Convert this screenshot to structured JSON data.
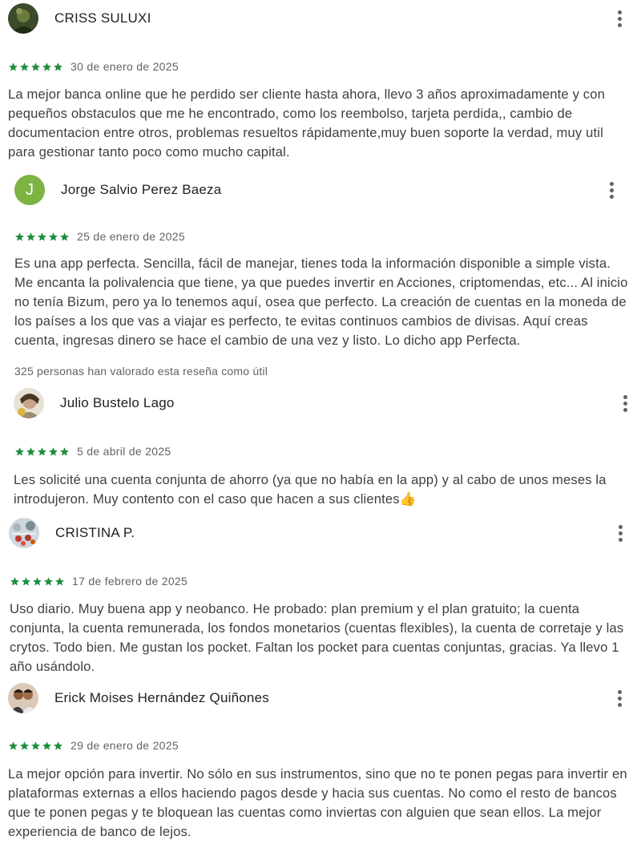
{
  "colors": {
    "star": "#1e8e3e",
    "avatar_letter_bg": "#7cb342",
    "text": "#3c4043",
    "muted": "#5f6368"
  },
  "reviews": [
    {
      "name": "CRISS SULUXI",
      "avatar": "photo",
      "rating": 5,
      "date": "30 de enero de 2025",
      "text": "La mejor banca online que he perdido ser cliente hasta ahora, llevo 3 años aproximadamente y con pequeños obstaculos que me he encontrado, como los reembolso, tarjeta perdida,, cambio de documentacion entre otros, problemas resueltos rápidamente,muy buen soporte la verdad, muy util para gestionar tanto poco como mucho capital."
    },
    {
      "name": "Jorge Salvio Perez Baeza",
      "avatar": "letter",
      "avatar_letter": "J",
      "rating": 5,
      "date": "25 de enero de 2025",
      "text": "Es una app perfecta. Sencilla, fácil de manejar, tienes toda la información disponible a simple vista. Me encanta la polivalencia que tiene, ya que puedes invertir en Acciones, criptomendas, etc... Al inicio no tenía Bizum, pero ya lo tenemos aquí, osea que perfecto. La creación de cuentas en la moneda de los países a los que vas a viajar es perfecto, te evitas continuos cambios de divisas. Aquí creas cuenta, ingresas dinero se hace el cambio de una vez y listo. Lo dicho app Perfecta.",
      "helpful": "325 personas han valorado esta reseña como útil"
    },
    {
      "name": "Julio Bustelo Lago",
      "avatar": "photo",
      "rating": 5,
      "date": "5 de abril de 2025",
      "text": "Les solicité una cuenta conjunta de ahorro (ya que no había en la app) y al cabo de unos meses la introdujeron. Muy contento con el caso que hacen a sus clientes👍"
    },
    {
      "name": "CRISTINA P.",
      "avatar": "photo",
      "rating": 5,
      "date": "17 de febrero de 2025",
      "text": "Uso diario. Muy buena app y neobanco. He probado: plan premium y el plan gratuito; la cuenta conjunta, la cuenta remunerada, los fondos monetarios (cuentas flexibles), la cuenta de corretaje y las crytos. Todo bien. Me gustan los pocket. Faltan los pocket para cuentas conjuntas, gracias. Ya llevo 1 año usándolo."
    },
    {
      "name": "Erick Moises Hernández Quiñones",
      "avatar": "photo",
      "rating": 5,
      "date": "29 de enero de 2025",
      "text": "La mejor opción para invertir. No sólo en sus instrumentos, sino que no te ponen pegas para invertir en plataformas externas a ellos haciendo pagos desde y hacia sus cuentas. No como el resto de bancos que te ponen pegas y te bloquean las cuentas como inviertas con alguien que sean ellos. La mejor experiencia de banco de lejos."
    }
  ]
}
